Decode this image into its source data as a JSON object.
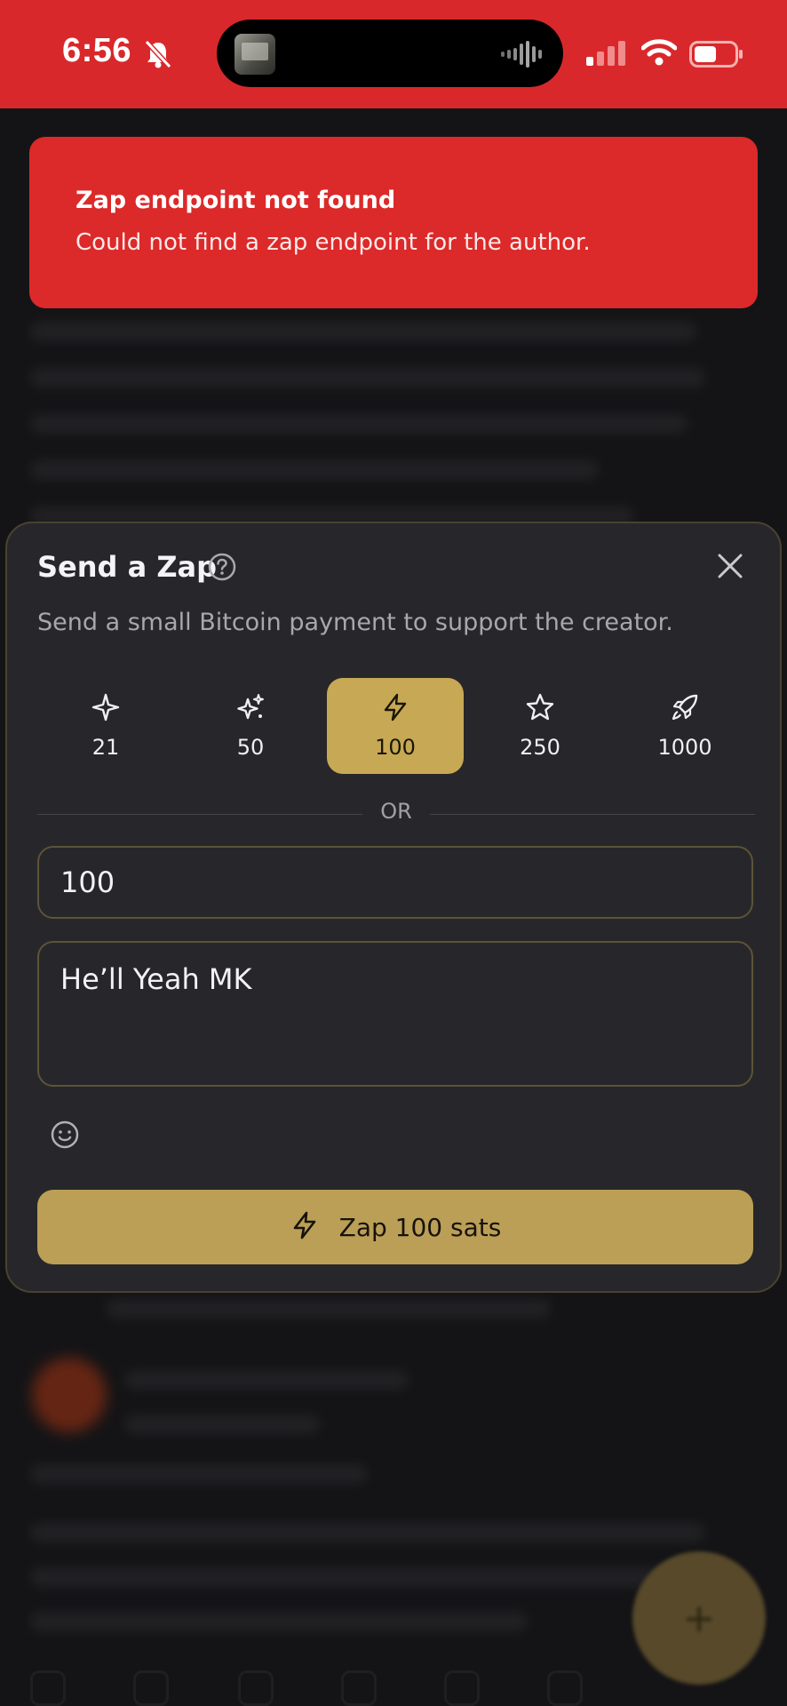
{
  "status_bar": {
    "time": "6:56",
    "icons": [
      "bell-slash-icon",
      "audio-wave-icon",
      "cellular-signal-icon",
      "wifi-icon",
      "battery-icon"
    ]
  },
  "toast": {
    "title": "Zap endpoint not found",
    "message": "Could not find a zap endpoint for the author."
  },
  "zap_dialog": {
    "title": "Send a Zap",
    "subtitle": "Send a small Bitcoin payment to support the creator.",
    "amounts": [
      {
        "value": "21",
        "icon": "sparkle-icon",
        "selected": false
      },
      {
        "value": "50",
        "icon": "sparkles-icon",
        "selected": false
      },
      {
        "value": "100",
        "icon": "lightning-icon",
        "selected": true
      },
      {
        "value": "250",
        "icon": "star-icon",
        "selected": false
      },
      {
        "value": "1000",
        "icon": "rocket-icon",
        "selected": false
      }
    ],
    "divider_text": "OR",
    "amount_input_value": "100",
    "comment_value": "He’ll Yeah MK",
    "submit_label": "Zap 100 sats"
  },
  "colors": {
    "status_bar_bg": "#d9282b",
    "toast_bg": "#dc2929",
    "sheet_bg": "#27272b",
    "accent_gold": "#c7a955",
    "button_gold": "#bb9f56"
  }
}
